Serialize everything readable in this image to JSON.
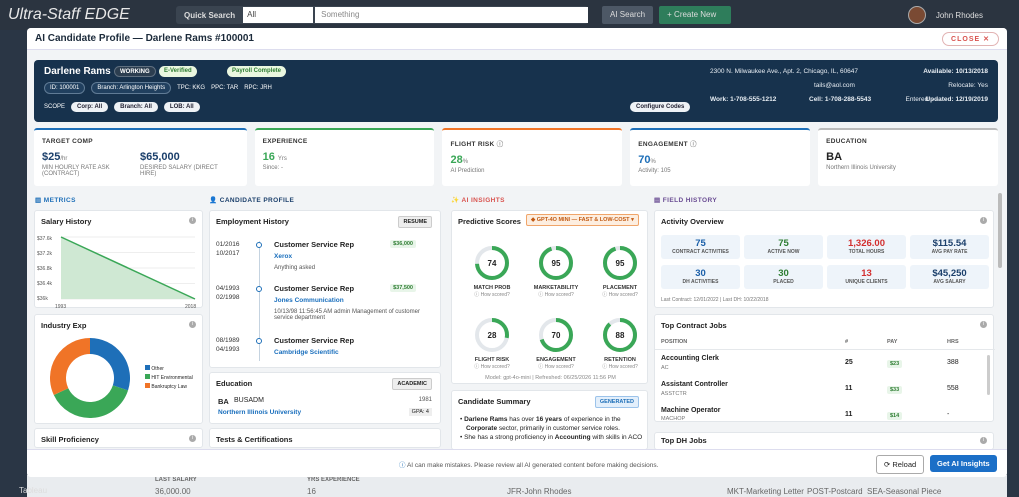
{
  "app": {
    "brand": "Ultra-Staff EDGE",
    "quick_search_label": "Quick Search",
    "search_scope": "All",
    "search_placeholder": "Something",
    "ai_search": "AI Search",
    "create_new": "+ Create New",
    "user_name": "John Rhodes"
  },
  "modal": {
    "title": "AI Candidate Profile — Darlene Rams #100001",
    "close_label": "CLOSE"
  },
  "hero": {
    "name": "Darlene Rams",
    "status": "WORKING",
    "everified": "E-Verified",
    "payroll": "Payroll Complete",
    "id": "ID: 100001",
    "branch": "Branch: Arlington Heights",
    "tpc": "TPC: KKG",
    "ppc": "PPC: TAR",
    "rpc": "RPC: JRH",
    "scope": "SCOPE",
    "corp": "Corp: All",
    "branch_filter": "Branch: All",
    "lob": "LOB: All",
    "configure": "Configure Codes",
    "address": "2300 N. Milwaukee Ave., Apt. 2, Chicago, IL, 60647",
    "email": "tails@aol.com",
    "work": "Work: 1-708-555-1212",
    "cell": "Cell: 1-708-288-5543",
    "available": "Available: 10/13/2018",
    "relocate": "Relocate: Yes",
    "entered": "Entered: - -",
    "updated": "Updated: 12/19/2019"
  },
  "kpis": [
    {
      "title": "TARGET COMP",
      "value": "$25",
      "unit": "/hr",
      "sub": "MIN HOURLY RATE ASK (CONTRACT)",
      "value2": "$65,000",
      "sub2": "DESIRED SALARY (DIRECT HIRE)"
    },
    {
      "title": "EXPERIENCE",
      "value": "16",
      "unit": "Yrs",
      "sub": "Since: -"
    },
    {
      "title": "FLIGHT RISK",
      "value": "28",
      "unit": "%",
      "sub": "AI Prediction"
    },
    {
      "title": "ENGAGEMENT",
      "value": "70",
      "unit": "%",
      "sub": "Activity: 105"
    },
    {
      "title": "EDUCATION",
      "value": "BA",
      "unit": "",
      "sub": "Northern Illinois University"
    }
  ],
  "sections": {
    "metrics": "METRICS",
    "profile": "CANDIDATE PROFILE",
    "insights": "AI INSIGHTS",
    "history": "FIELD HISTORY"
  },
  "salary_history": {
    "title": "Salary History",
    "yticks": [
      "$37.6k",
      "$37.2k",
      "$36.8k",
      "$36.4k",
      "$36k"
    ],
    "xticks": [
      "1993",
      "2018"
    ]
  },
  "industry": {
    "title": "Industry Exp",
    "legend": [
      "Other",
      "HIT Environmental",
      "Bankruptcy Law"
    ],
    "colors": [
      "#1e6fb8",
      "#3aa757",
      "#f07427"
    ],
    "shares": [
      0.3,
      0.38,
      0.32
    ]
  },
  "skill": {
    "title": "Skill Proficiency"
  },
  "employment": {
    "title": "Employment History",
    "badge": "RESUME",
    "jobs": [
      {
        "from": "01/2016",
        "to": "10/2017",
        "title": "Customer Service Rep",
        "company": "Xerox",
        "note": "Anything asked",
        "salary": "$36,000"
      },
      {
        "from": "04/1993",
        "to": "02/1998",
        "title": "Customer Service Rep",
        "company": "Jones Communication",
        "note": "10/13/98 11:56:45 AM admin Management of customer service department",
        "salary": "$37,500"
      },
      {
        "from": "08/1989",
        "to": "04/1993",
        "title": "Customer Service Rep",
        "company": "Cambridge Scientific",
        "note": "",
        "salary": ""
      }
    ]
  },
  "education": {
    "title": "Education",
    "badge": "ACADEMIC",
    "degree": "BA",
    "field": "BUSADM",
    "year": "1981",
    "school": "Northern Illinois University",
    "gpa": "GPA: 4"
  },
  "tests": {
    "title": "Tests & Certifications"
  },
  "predictive": {
    "title": "Predictive Scores",
    "model_badge": "GPT-4O MINI — FAST & LOW-COST",
    "scores": [
      {
        "label": "MATCH PROB",
        "value": 74
      },
      {
        "label": "MARKETABILITY",
        "value": 95
      },
      {
        "label": "PLACEMENT",
        "value": 95
      },
      {
        "label": "FLIGHT RISK",
        "value": 28
      },
      {
        "label": "ENGAGEMENT",
        "value": 70
      },
      {
        "label": "RETENTION",
        "value": 88
      }
    ],
    "how": "How scored?",
    "model": "Model: gpt-4o-mini",
    "refreshed": "Refreshed: 06/25/2026 11:56 PM"
  },
  "summary": {
    "title": "Candidate Summary",
    "badge": "GENERATED",
    "b1_pre": "Darlene Rams",
    "b1_mid": " has over ",
    "b1_bold": "16 years",
    "b1_post": " of experience in the",
    "b1_l2_bold": "Corporate",
    "b1_l2_post": " sector, primarily in customer service roles.",
    "b2_pre": "She has a strong proficiency in ",
    "b2_bold": "Accounting",
    "b2_post": " with skills in ACO"
  },
  "activity": {
    "title": "Activity Overview",
    "stats": [
      {
        "value": "75",
        "label": "CONTRACT ACTIVITIES",
        "color": "#1b5fa8"
      },
      {
        "value": "75",
        "label": "ACTIVE NOW",
        "color": "#2e7d32"
      },
      {
        "value": "1,326.00",
        "label": "TOTAL HOURS",
        "color": "#d32f2f"
      },
      {
        "value": "$115.54",
        "label": "AVG PAY RATE",
        "color": "#1b3f6b"
      },
      {
        "value": "30",
        "label": "DH ACTIVITIES",
        "color": "#1b5fa8"
      },
      {
        "value": "30",
        "label": "PLACED",
        "color": "#2e7d32"
      },
      {
        "value": "13",
        "label": "UNIQUE CLIENTS",
        "color": "#d32f2f"
      },
      {
        "value": "$45,250",
        "label": "AVG SALARY",
        "color": "#1b3f6b"
      }
    ],
    "last": "Last Contract: 12/01/2022  |  Last DH: 10/22/2018"
  },
  "contract_jobs": {
    "title": "Top Contract Jobs",
    "cols": [
      "POSITION",
      "#",
      "PAY",
      "HRS"
    ],
    "rows": [
      {
        "pos": "Accounting Clerk",
        "code": "AC",
        "count": "25",
        "pay": "$23",
        "hrs": "388"
      },
      {
        "pos": "Assistant Controller",
        "code": "ASSTCTR",
        "count": "11",
        "pay": "$33",
        "hrs": "558"
      },
      {
        "pos": "Machine Operator",
        "code": "MACHOP",
        "count": "11",
        "pay": "$14",
        "hrs": "-"
      }
    ]
  },
  "dh_jobs": {
    "title": "Top DH Jobs"
  },
  "footer": {
    "disclaimer": "AI can make mistakes. Please review all AI generated content before making decisions.",
    "reload": "Reload",
    "insights": "Get AI Insights"
  },
  "background": {
    "col1": "LAST SALARY",
    "col2": "YRS EXPERIENCE",
    "v1": "36,000.00",
    "v2": "16",
    "tableau": "Tableau",
    "rep": "JFR-John Rhodes",
    "mkt": "MKT-Marketing Letter",
    "post": "POST-Postcard",
    "sea": "SEA-Seasonal Piece"
  }
}
